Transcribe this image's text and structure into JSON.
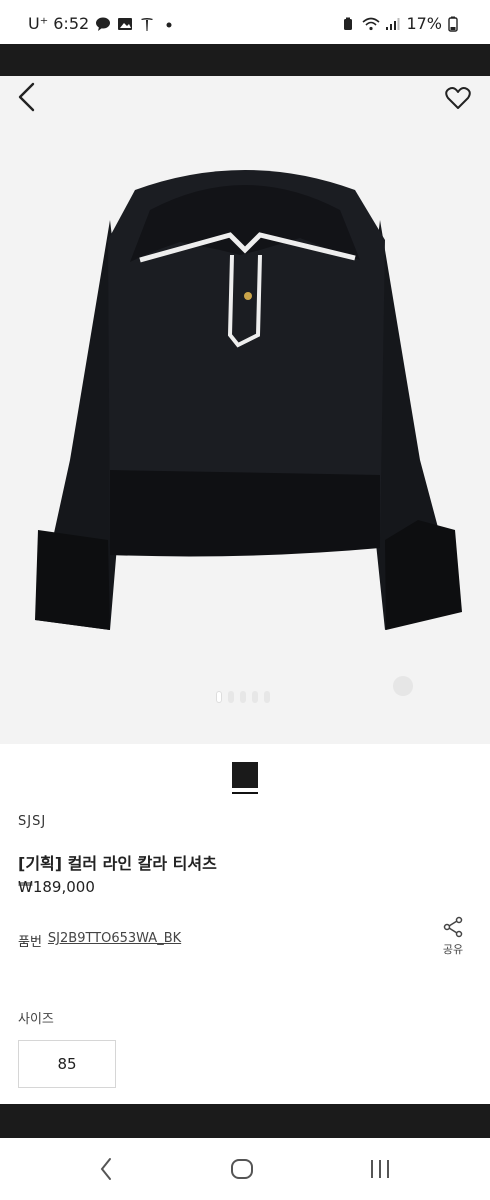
{
  "statusbar": {
    "time": "U⁺ 6:52",
    "battery": "17%"
  },
  "product": {
    "brand": "SJSJ",
    "title": "[기획] 컬러 라인 칼라 티셔츠",
    "price": "₩189,000",
    "code_label": "품번",
    "code_value": "SJ2B9TTO653WA_BK",
    "share_label": "공유",
    "size_label": "사이즈",
    "size_value": "85",
    "swatch_color": "#1a1a1a"
  },
  "carousel": {
    "total": 5,
    "active": 1
  },
  "icons": {
    "back": "back-arrow-icon",
    "heart": "heart-icon",
    "share": "share-icon",
    "nav_back": "chevron-left-icon",
    "nav_home": "home-icon",
    "nav_recent": "recent-apps-icon"
  }
}
